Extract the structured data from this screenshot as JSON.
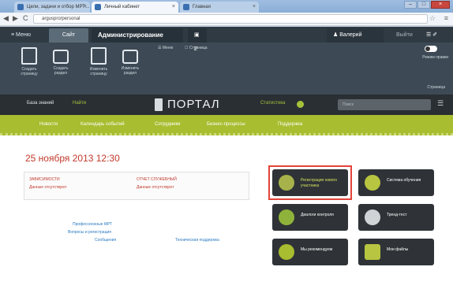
{
  "browser": {
    "tabs": [
      {
        "label": "Цели, задачи и отбор МРТ…",
        "close": "×"
      },
      {
        "label": "Личный кабинет",
        "close": "×"
      },
      {
        "label": "Главная",
        "close": "×"
      }
    ],
    "window_controls": {
      "minimize": "–",
      "maximize": "□",
      "close": "×"
    },
    "back": "◀",
    "forward": "▶",
    "reload": "C",
    "url": "arguspro/personal"
  },
  "ribbon": {
    "menu_label": "≡ Меню",
    "tab_active": "Сайт",
    "tab_admin": "Администрирование",
    "tab_counter": "▣ 2",
    "user": "♟ Валерий",
    "exit": "Выйти",
    "tools": "☰ ✐",
    "buttons": [
      {
        "label": "Создать страницу"
      },
      {
        "label": "Создать раздел"
      },
      {
        "label": "Изменить страницу"
      },
      {
        "label": "Изменить раздел"
      }
    ],
    "small_menu": "☰ Меню",
    "small_page": "☐ Страница",
    "toggle_label": "Режим правки",
    "section_label": "Страница"
  },
  "portal": {
    "base": "База знаний",
    "link": "Найти",
    "logo": "ПОРТАЛ",
    "status": "Статистика",
    "search_placeholder": "Поиск",
    "search_icon": "☰"
  },
  "nav": [
    "Новости",
    "Календарь событий",
    "Сотрудники",
    "Бизнес-процессы",
    "Поддержка"
  ],
  "main": {
    "date": "25 ноября 2013   12:30",
    "col1_title": "ЗАВИСИМОСТИ",
    "col1_value": "Данные отсутствуют",
    "col2_title": "ОТЧЕТ СЛУЖЕБНЫЙ",
    "col2_value": "Данные отсутствуют",
    "links": [
      "Профессионные МРТ",
      "Вопросы и регистрация",
      "Сообщения",
      "Техническая поддержка"
    ],
    "tiles": [
      {
        "label": "Регистрация нового участника",
        "icon": "shield-icon",
        "highlight": true
      },
      {
        "label": "Система обучения",
        "icon": "ribbon-icon",
        "highlight": false
      },
      {
        "label": "Диалоги контроля",
        "icon": "no-entry-icon",
        "highlight": false
      },
      {
        "label": "Тренд-тест",
        "icon": "phone-icon",
        "highlight": false
      },
      {
        "label": "Мы рекомендуем",
        "icon": "pin-icon",
        "highlight": false
      },
      {
        "label": "Мои файлы",
        "icon": "drive-icon",
        "highlight": false
      }
    ]
  },
  "colors": {
    "accent_green": "#a8bd2f",
    "date_red": "#c0392b",
    "highlight_border": "#e2433a",
    "tile_bg": "#2f3337"
  }
}
